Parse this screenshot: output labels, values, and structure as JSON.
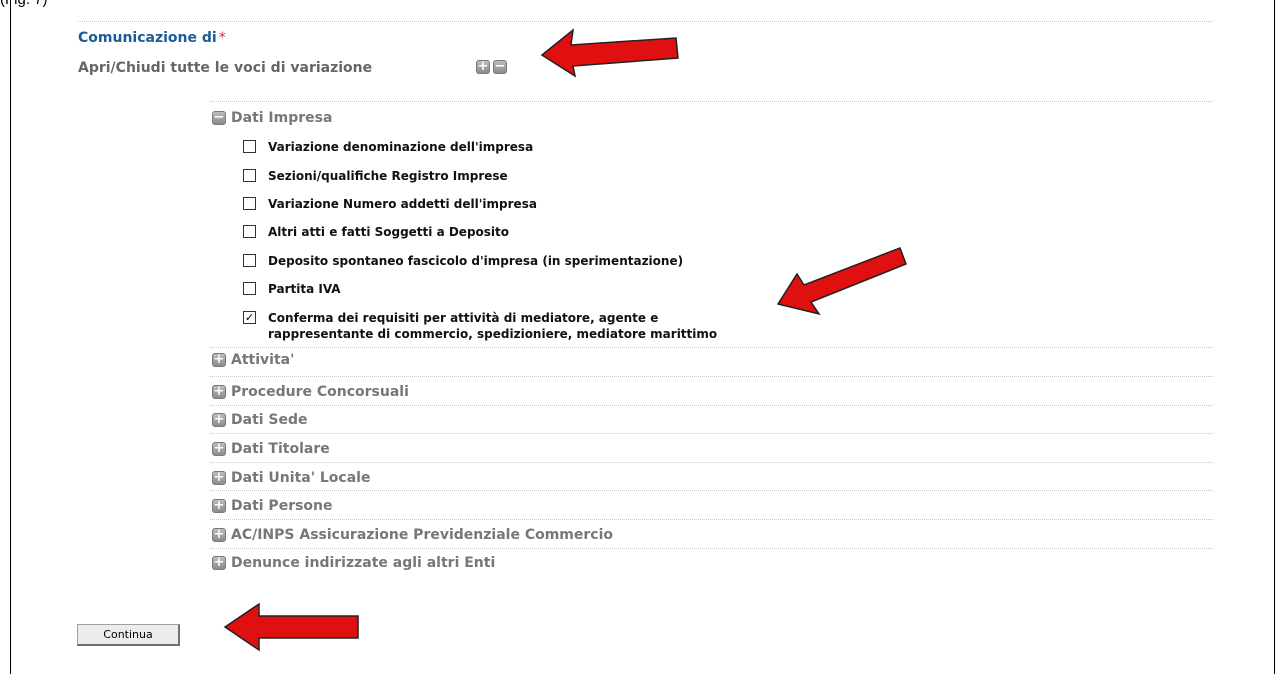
{
  "caption": "(Fig. 7)",
  "form": {
    "comunicazione_label": "Comunicazione di",
    "required_mark": "*",
    "toggle_all_label": "Apri/Chiudi tutte le voci di variazione"
  },
  "sections": [
    {
      "label": "Dati Impresa",
      "expanded": true
    },
    {
      "label": "Attivita'",
      "expanded": false
    },
    {
      "label": "Procedure Concorsuali",
      "expanded": false
    },
    {
      "label": "Dati Sede",
      "expanded": false
    },
    {
      "label": "Dati Titolare",
      "expanded": false
    },
    {
      "label": "Dati Unita' Locale",
      "expanded": false
    },
    {
      "label": "Dati Persone",
      "expanded": false
    },
    {
      "label": "AC/INPS Assicurazione Previdenziale Commercio",
      "expanded": false
    },
    {
      "label": "Denunce indirizzate agli altri Enti",
      "expanded": false
    }
  ],
  "dati_impresa_options": [
    {
      "label": "Variazione denominazione dell'impresa",
      "checked": false
    },
    {
      "label": "Sezioni/qualifiche Registro Imprese",
      "checked": false
    },
    {
      "label": "Variazione Numero addetti dell'impresa",
      "checked": false
    },
    {
      "label": "Altri atti e fatti Soggetti a Deposito",
      "checked": false
    },
    {
      "label": "Deposito spontaneo fascicolo d'impresa (in sperimentazione)",
      "checked": false
    },
    {
      "label": "Partita IVA",
      "checked": false
    },
    {
      "label": "Conferma dei requisiti per attività di mediatore, agente e",
      "label_line2": "rappresentante di commercio, spedizioniere, mediatore marittimo",
      "checked": true
    }
  ],
  "icons": {
    "expand": "plus-icon",
    "collapse": "minus-icon",
    "checkmark": "✓",
    "arrow_color": "#e01010"
  },
  "buttons": {
    "continue_label": "Continua"
  }
}
